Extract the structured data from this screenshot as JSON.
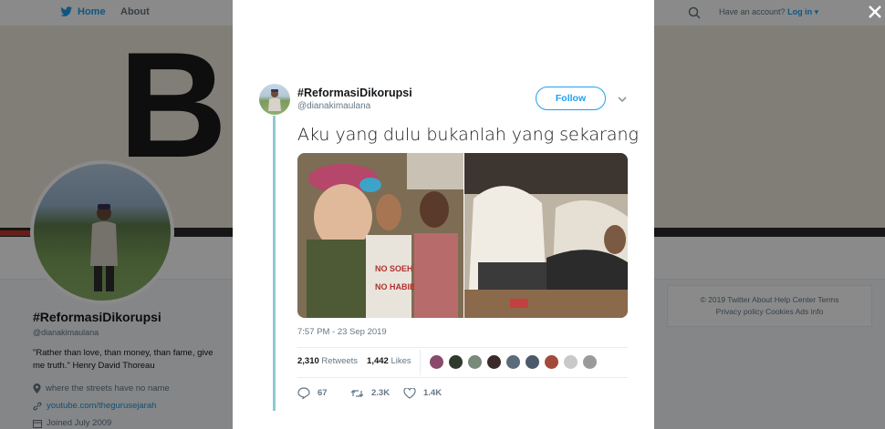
{
  "nav": {
    "home_label": "Home",
    "about_label": "About",
    "account_prompt": "Have an account?",
    "login_label": "Log in"
  },
  "banner": {
    "text": "B      D."
  },
  "profile": {
    "name": "#ReformasiDikorupsi",
    "handle": "@dianakimaulana",
    "bio": "\"Rather than love, than money, than fame, give me truth.\" Henry David Thoreau",
    "location": "where the streets have no name",
    "link": "youtube.com/thegurusejarah",
    "joined": "Joined July 2009"
  },
  "footer": {
    "line1": "© 2019 Twitter   About   Help Center   Terms",
    "line2": "Privacy policy   Cookies   Ads info"
  },
  "tweet": {
    "name": "#ReformasiDikorupsi",
    "handle": "@dianakimaulana",
    "follow_label": "Follow",
    "text": "Aku yang dulu bukanlah yang sekarang",
    "time": "7:57 PM - 23 Sep 2019",
    "retweets_count": "2,310",
    "retweets_label": "Retweets",
    "likes_count": "1,442",
    "likes_label": "Likes",
    "reply_count": "67",
    "retweet_action_count": "2.3K",
    "like_action_count": "1.4K"
  },
  "colors": {
    "accent": "#1da1f2",
    "thread_line": "#8fc9d3",
    "overlay": "rgba(0,0,0,0.46)"
  },
  "likers": [
    "#8a4a6b",
    "#2e3a2c",
    "#7a8a7a",
    "#3b2a2a",
    "#5a6b7a",
    "#4a5a6a",
    "#a34a3a",
    "#c9c9c9",
    "#9a9a9a"
  ]
}
